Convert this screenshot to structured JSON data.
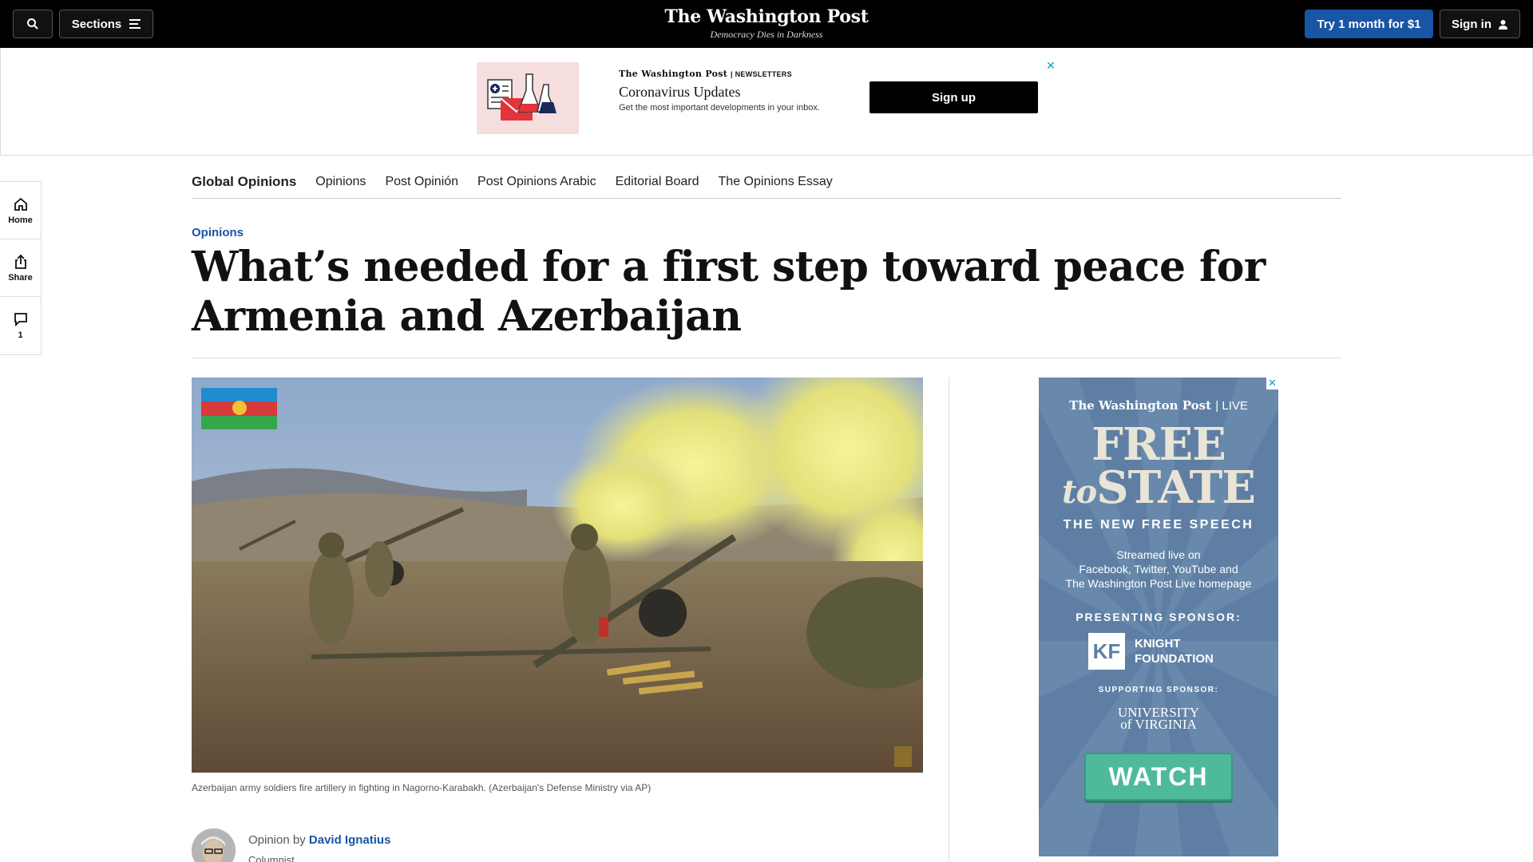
{
  "header": {
    "search_icon": "search-icon",
    "sections_label": "Sections",
    "logo": "The Washington Post",
    "tagline": "Democracy Dies in Darkness",
    "try_label": "Try 1 month for $1",
    "signin_label": "Sign in"
  },
  "top_ad": {
    "brand": "The Washington Post",
    "brand_suffix": "| NEWSLETTERS",
    "title": "Coronavirus Updates",
    "description": "Get the most important developments in your inbox.",
    "cta": "Sign up",
    "close": "✕"
  },
  "section_nav": {
    "active": "Global Opinions",
    "items": [
      "Opinions",
      "Post Opinión",
      "Post Opinions Arabic",
      "Editorial Board",
      "The Opinions Essay"
    ]
  },
  "left_rail": {
    "home": "Home",
    "share": "Share",
    "comments": "1"
  },
  "article": {
    "kicker": "Opinions",
    "headline": "What’s needed for a first step toward peace for Armenia and Azerbaijan",
    "caption": "Azerbaijan army soldiers fire artillery in fighting in Nagorno-Karabakh. (Azerbaijan's Defense Ministry via AP)",
    "byline_prefix": "Opinion by",
    "author": "David Ignatius",
    "role": "Columnist"
  },
  "side_ad": {
    "brand": "The Washington Post",
    "brand_suffix": "| LIVE",
    "free": "FREE",
    "to": "to",
    "state": "STATE",
    "subtitle": "THE NEW FREE SPEECH",
    "stream_line1": "Streamed live on",
    "stream_line2": "Facebook, Twitter, YouTube and",
    "stream_line3": "The Washington Post Live homepage",
    "presenting": "PRESENTING SPONSOR:",
    "knight_logo": "KF",
    "knight_line1": "KNIGHT",
    "knight_line2": "FOUNDATION",
    "supporting": "SUPPORTING SPONSOR:",
    "uva_line1": "UNIVERSITY",
    "uva_line2": "of VIRGINIA",
    "watch": "WATCH",
    "close": "✕"
  },
  "colors": {
    "brand_blue": "#1955a5",
    "topbar": "#000000",
    "ad_blue": "#5e7fa3",
    "watch_green": "#4fb99c"
  }
}
